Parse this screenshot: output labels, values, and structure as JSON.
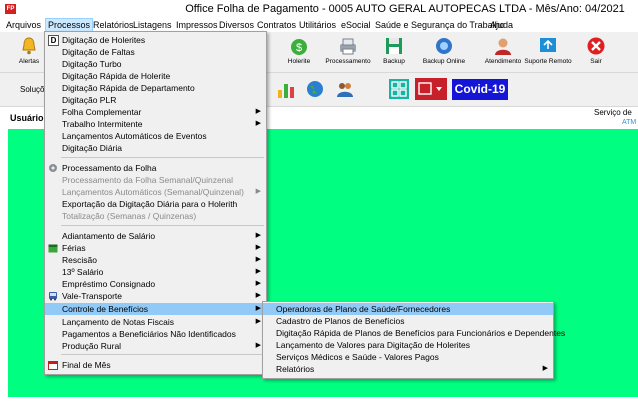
{
  "window": {
    "title": "Office Folha de Pagamento - 0005 AUTO GERAL AUTOPECAS LTDA - Mês/Ano: 04/2021",
    "app_icon": "FP"
  },
  "menubar": [
    "Arquivos",
    "Processos",
    "Relatórios",
    "Listagens",
    "Impressos",
    "Diversos",
    "Contratos",
    "Utilitários",
    "eSocial",
    "Saúde e Segurança do Trabalho",
    "Ajuda"
  ],
  "toolbar": {
    "alertas": "Alertas",
    "buttons": [
      {
        "label": "Holerite",
        "icon": "money-bag-icon"
      },
      {
        "label": "Processamento",
        "icon": "printer-icon"
      },
      {
        "label": "Backup",
        "icon": "floppy-icon"
      },
      {
        "label": "Backup Online",
        "icon": "cloud-backup-icon"
      },
      {
        "label": "Atendimento",
        "icon": "support-person-icon"
      },
      {
        "label": "Suporte Remoto",
        "icon": "remote-support-icon"
      },
      {
        "label": "Sair",
        "icon": "exit-icon"
      }
    ]
  },
  "toolbar2": {
    "solucoes": "Soluçõe",
    "covid": "Covid-19"
  },
  "status": {
    "user": "Usuário a",
    "service": "Serviço de",
    "atm": "ATM"
  },
  "processos_menu": [
    {
      "label": "Digitação de Holerites",
      "icon": "d-icon",
      "submenu": false,
      "disabled": false
    },
    {
      "label": "Digitação de Faltas",
      "submenu": false,
      "disabled": false
    },
    {
      "label": "Digitação Turbo",
      "submenu": false,
      "disabled": false
    },
    {
      "label": "Digitação Rápida de Holerite",
      "submenu": false,
      "disabled": false
    },
    {
      "label": "Digitação Rápida de Departamento",
      "submenu": false,
      "disabled": false
    },
    {
      "label": "Digitação PLR",
      "submenu": false,
      "disabled": false
    },
    {
      "label": "Folha Complementar",
      "submenu": true,
      "disabled": false
    },
    {
      "label": "Trabalho Intermitente",
      "submenu": true,
      "disabled": false
    },
    {
      "label": "Lançamentos Automáticos de Eventos",
      "submenu": false,
      "disabled": false
    },
    {
      "label": "Digitação Diária",
      "submenu": false,
      "disabled": false
    },
    {
      "sep": true
    },
    {
      "label": "Processamento da Folha",
      "icon": "gear-icon",
      "submenu": false,
      "disabled": false
    },
    {
      "label": "Processamento da Folha Semanal/Quinzenal",
      "submenu": false,
      "disabled": true
    },
    {
      "label": "Lançamentos Automáticos (Semanal/Quinzenal)",
      "submenu": true,
      "disabled": true
    },
    {
      "label": "Exportação da Digitação Diária para o Holerith",
      "submenu": false,
      "disabled": false
    },
    {
      "label": "Totalização (Semanas / Quinzenas)",
      "submenu": false,
      "disabled": true
    },
    {
      "sep": true
    },
    {
      "label": "Adiantamento de Salário",
      "submenu": true,
      "disabled": false
    },
    {
      "label": "Férias",
      "icon": "calendar-icon",
      "submenu": true,
      "disabled": false
    },
    {
      "label": "Rescisão",
      "submenu": true,
      "disabled": false
    },
    {
      "label": "13º Salário",
      "submenu": true,
      "disabled": false
    },
    {
      "label": "Empréstimo Consignado",
      "submenu": true,
      "disabled": false
    },
    {
      "label": "Vale-Transporte",
      "icon": "bus-icon",
      "submenu": true,
      "disabled": false
    },
    {
      "label": "Controle de Benefícios",
      "submenu": true,
      "disabled": false,
      "highlight": true
    },
    {
      "label": "Lançamento de Notas Fiscais",
      "submenu": true,
      "disabled": false
    },
    {
      "label": "Pagamentos a Beneficiários Não Identificados",
      "submenu": false,
      "disabled": false
    },
    {
      "label": "Produção Rural",
      "submenu": true,
      "disabled": false
    },
    {
      "sep": true
    },
    {
      "label": "Final de Mês",
      "icon": "calendar-red-icon",
      "submenu": false,
      "disabled": false
    }
  ],
  "beneficios_submenu": [
    {
      "label": "Operadoras de Plano de Saúde/Fornecedores",
      "highlight": true,
      "submenu": false
    },
    {
      "label": "Cadastro de Planos de Benefícios",
      "submenu": false
    },
    {
      "label": "Digitação Rápida de Planos de Benefícios para Funcionários e Dependentes",
      "submenu": false
    },
    {
      "label": "Lançamento de Valores para Digitação de Holerites",
      "submenu": false
    },
    {
      "label": "Serviços Médicos e Saúde - Valores Pagos",
      "submenu": false
    },
    {
      "label": "Relatórios",
      "submenu": true
    }
  ],
  "colors": {
    "workspace": "#00ff80",
    "menu_highlight": "#91c9f7",
    "covid_bg": "#1515d8"
  }
}
